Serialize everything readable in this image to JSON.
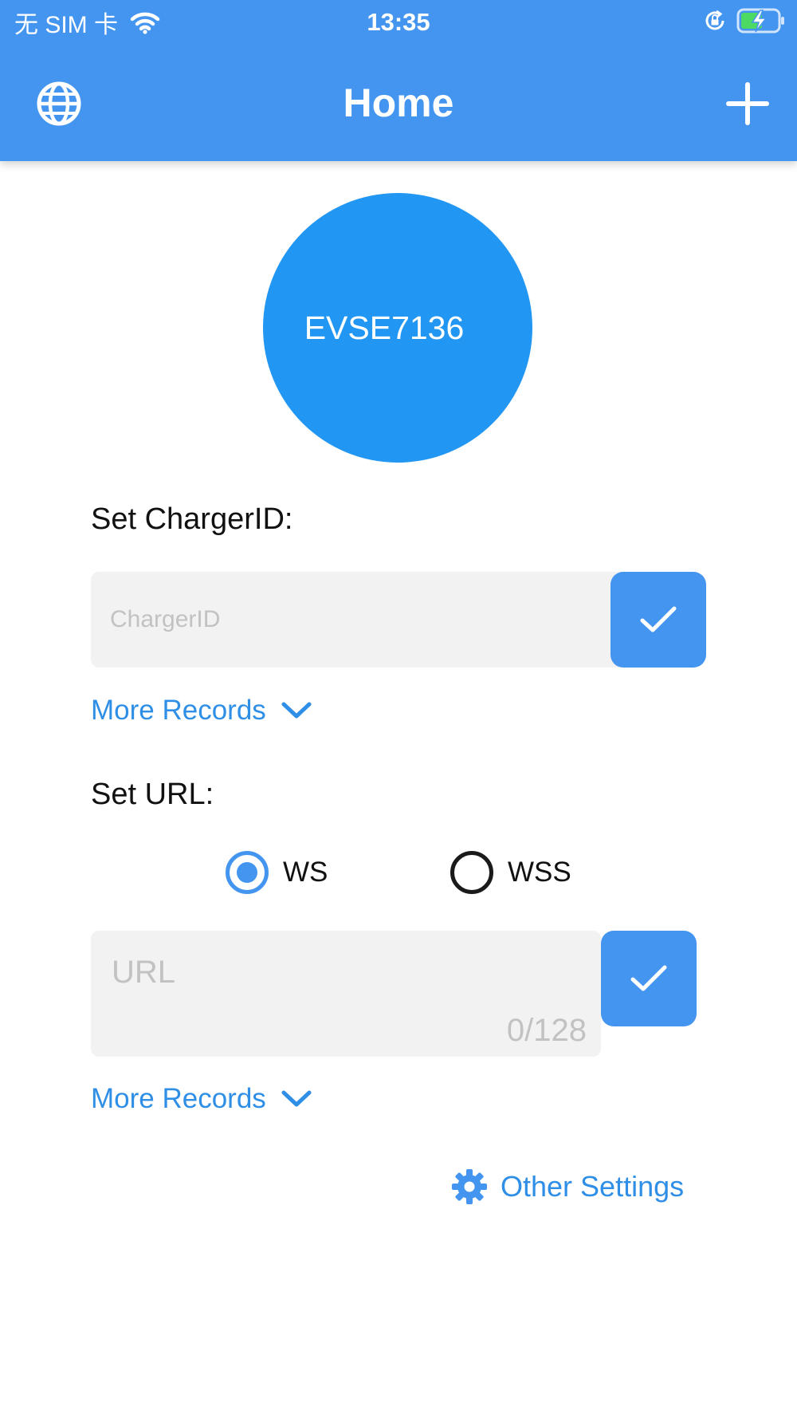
{
  "status_bar": {
    "carrier": "无 SIM 卡",
    "time": "13:35"
  },
  "nav": {
    "title": "Home",
    "left_icon": "globe-icon",
    "right_icon": "plus-icon"
  },
  "charger": {
    "name": "EVSE7136"
  },
  "charger_id_section": {
    "label": "Set ChargerID:",
    "value": "",
    "placeholder": "ChargerID",
    "more_records_label": "More Records"
  },
  "url_section": {
    "label": "Set URL:",
    "protocols": [
      {
        "label": "WS",
        "selected": true
      },
      {
        "label": "WSS",
        "selected": false
      }
    ],
    "value": "",
    "placeholder": "URL",
    "counter": "0/128",
    "more_records_label": "More Records"
  },
  "other_settings": {
    "label": "Other Settings",
    "icon": "gear-icon"
  },
  "colors": {
    "header": "#4495f0",
    "circle": "#2196f3",
    "accent_text": "#2f8fe6",
    "input_bg": "#f2f2f2"
  }
}
